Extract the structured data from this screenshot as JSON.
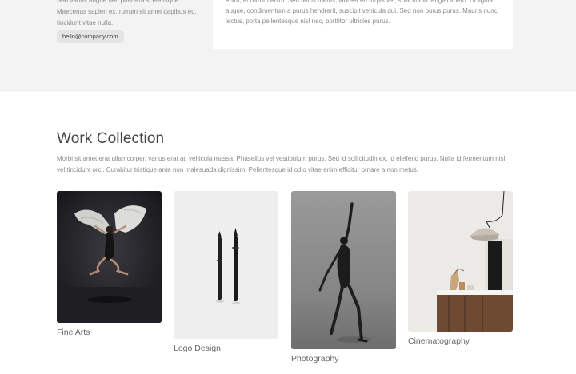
{
  "contact": {
    "intro_text": "Sed varius augue nec pharetra scelerisque. Maecenas sapien ex, rutrum sit amet dapibus eu, tincidunt vitae nulla.",
    "email": "hello@company.com"
  },
  "about_card": {
    "text": "enim, at rutrum enim. Sed tellus metus, laoreet eu turpis vel, sollicitudin feugiat libero. Ut ligula augue, condimentum a purus hendrerit, suscipit vehicula dui. Sed non purus purus. Mauris nunc lectus, porta pellentesque nisl nec, porttitor ultricies purus."
  },
  "work_collection": {
    "title": "Work Collection",
    "description": "Morbi sit amet erat ullamcorper, varius erat at, vehicula massa. Phasellus vel vestibulum purus. Sed id sollicitudin ex, id eleifend purus. Nulla id fermentum nisl, vel tincidunt orci. Curabitur tristique ante non malesuada dignissim. Pellentesque id odio vitae enim efficitur ornare a non metus.",
    "items": [
      {
        "label": "Fine Arts"
      },
      {
        "label": "Logo Design"
      },
      {
        "label": "Photography"
      },
      {
        "label": "Cinematography"
      }
    ]
  }
}
